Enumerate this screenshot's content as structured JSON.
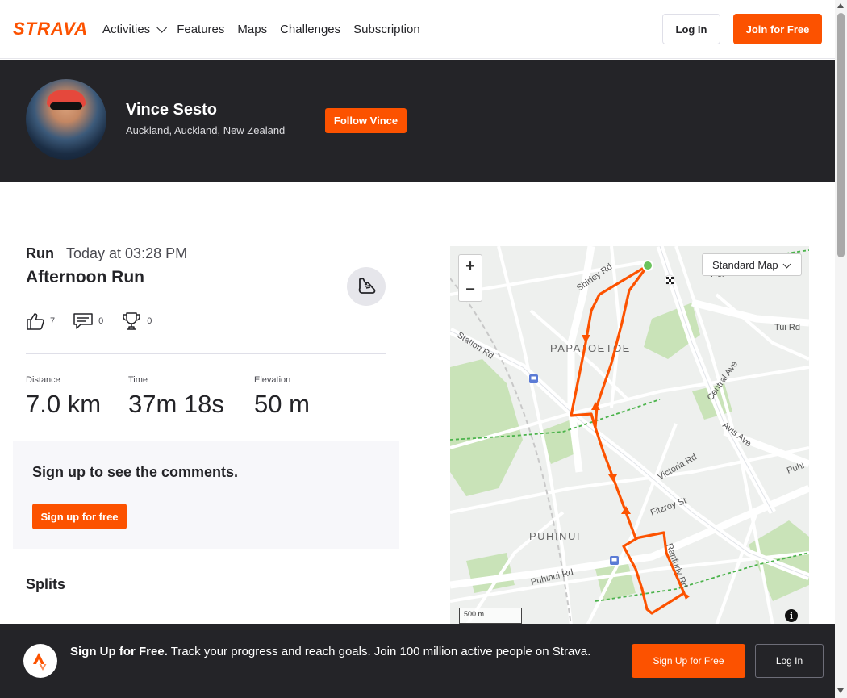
{
  "nav": {
    "logo": "STRAVA",
    "links": [
      "Activities",
      "Features",
      "Maps",
      "Challenges",
      "Subscription"
    ],
    "login": "Log In",
    "join": "Join for Free"
  },
  "athlete": {
    "name": "Vince Sesto",
    "location": "Auckland, Auckland, New Zealand",
    "follow": "Follow Vince"
  },
  "activity": {
    "type": "Run",
    "when": "Today at 03:28 PM",
    "title": "Afternoon Run",
    "kudos": "7",
    "comments": "0",
    "achievements": "0",
    "stats": [
      {
        "label": "Distance",
        "value": "7.0 km"
      },
      {
        "label": "Time",
        "value": "37m 18s"
      },
      {
        "label": "Elevation",
        "value": "50 m"
      }
    ]
  },
  "comments_box": {
    "title": "Sign up to see the comments.",
    "button": "Sign up for free"
  },
  "splits_title": "Splits",
  "map": {
    "map_type": "Standard Map",
    "scale": "500 m",
    "labels": {
      "papatoetoe": "PAPATOETOE",
      "puhinui": "PUHINUI",
      "shirley": "Shirley Rd",
      "station": "Station Rd",
      "tui": "Tui Rd",
      "central": "Central Ave",
      "avis": "Avis Ave",
      "victoria": "Victoria Rd",
      "fitzroy": "Fitzroy St",
      "ranfurly": "Ranfurly Rd",
      "puhinui_rd": "Puhinui Rd",
      "puhi": "Puhi",
      "hol": "Hol",
      "rd_top": "Rd"
    },
    "route_color": "#fc5200"
  },
  "banner": {
    "bold": "Sign Up for Free.",
    "text": " Track your progress and reach goals. Join 100 million active people on Strava.",
    "signup": "Sign Up for Free",
    "login": "Log In"
  },
  "colors": {
    "brand": "#fc5200",
    "dark": "#242428"
  }
}
